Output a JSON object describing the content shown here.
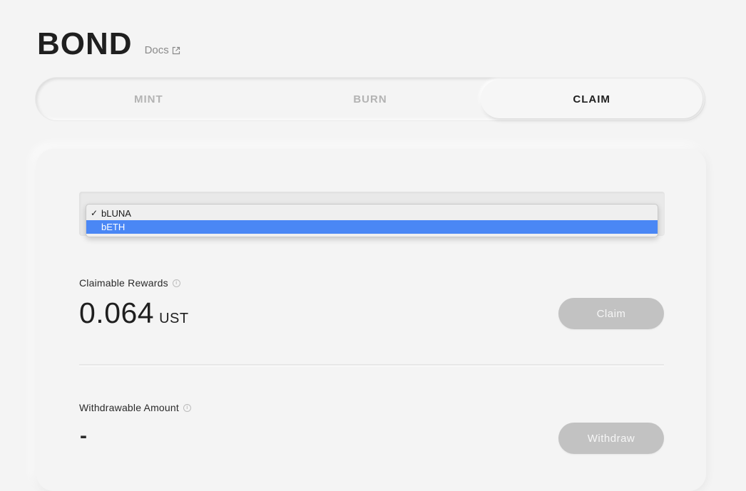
{
  "header": {
    "title": "BOND",
    "docs_label": "Docs",
    "docs_icon": "external-link-icon"
  },
  "tabs": [
    {
      "label": "MINT",
      "active": false
    },
    {
      "label": "BURN",
      "active": false
    },
    {
      "label": "CLAIM",
      "active": true
    }
  ],
  "asset_select": {
    "options": [
      {
        "label": "bLUNA",
        "selected": true
      },
      {
        "label": "bETH",
        "selected": false,
        "highlighted": true
      }
    ],
    "check_mark": "✓"
  },
  "claimable": {
    "label": "Claimable Rewards",
    "value": "0.064",
    "unit": "UST",
    "button_label": "Claim"
  },
  "withdrawable": {
    "label": "Withdrawable Amount",
    "value": "-",
    "button_label": "Withdraw"
  },
  "colors": {
    "background": "#f4f4f4",
    "highlight": "#4a87f5",
    "disabled_button": "#c2c2c2"
  }
}
